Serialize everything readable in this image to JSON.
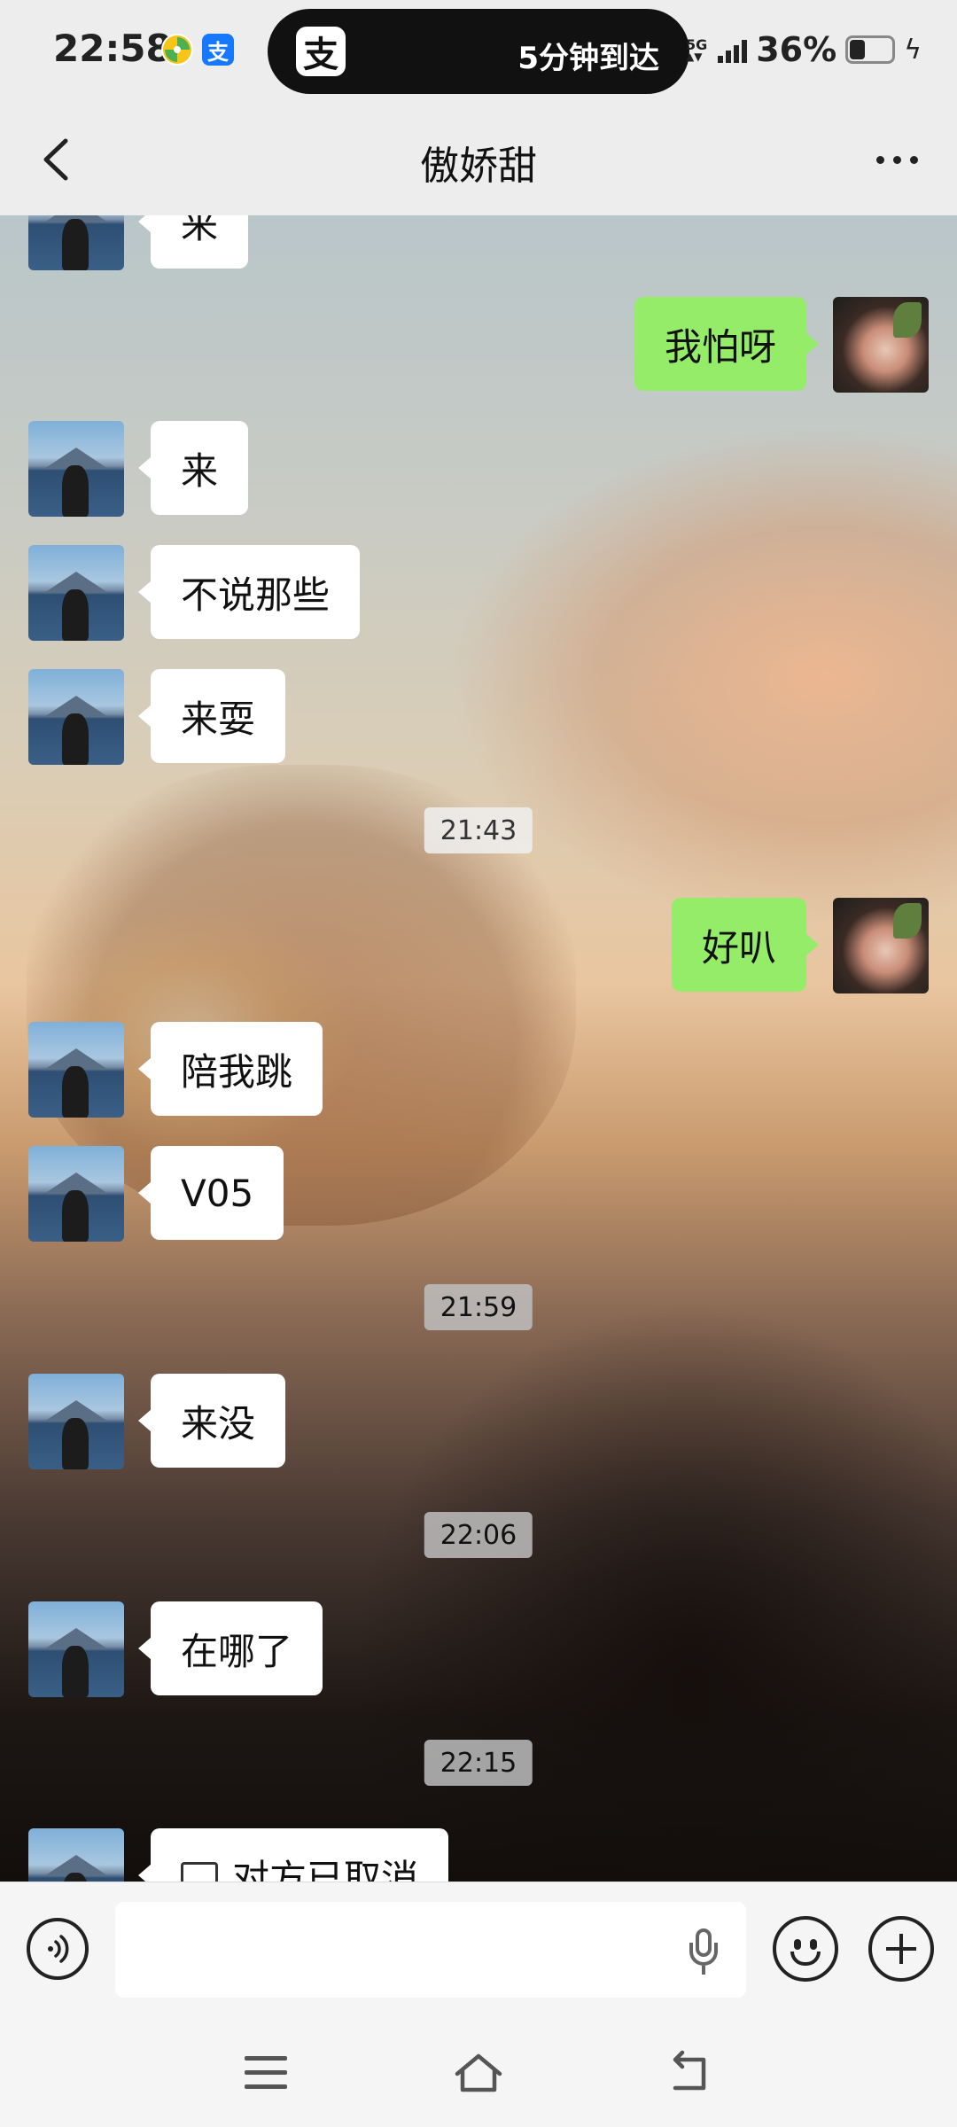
{
  "status_bar": {
    "time": "22:58",
    "app_icons": [
      "pinwheel-icon",
      "alipay-icon"
    ],
    "island_logo": "支",
    "island_text": "5分钟到达",
    "network": "5G",
    "battery_percent": "36%",
    "battery_level": 0.36,
    "charging": true
  },
  "header": {
    "title": "傲娇甜",
    "back_icon": "chevron-left-icon",
    "more_icon": "more-horizontal-icon"
  },
  "messages": [
    {
      "type": "in",
      "text": "来"
    },
    {
      "type": "out",
      "text": "我怕呀"
    },
    {
      "type": "in",
      "text": "来"
    },
    {
      "type": "in",
      "text": "不说那些"
    },
    {
      "type": "in",
      "text": "来耍"
    },
    {
      "type": "time",
      "text": "21:43"
    },
    {
      "type": "out",
      "text": "好叭"
    },
    {
      "type": "in",
      "text": "陪我跳"
    },
    {
      "type": "in",
      "text": "V05"
    },
    {
      "type": "time",
      "text": "21:59"
    },
    {
      "type": "in",
      "text": "来没"
    },
    {
      "type": "time",
      "text": "22:06"
    },
    {
      "type": "in",
      "text": "在哪了"
    },
    {
      "type": "time",
      "text": "22:15"
    },
    {
      "type": "in-video",
      "text": "对方已取消"
    }
  ],
  "input": {
    "placeholder": "",
    "value": ""
  },
  "colors": {
    "background": "#ededed",
    "bubble_out": "#95ec69",
    "bubble_in": "#ffffff"
  },
  "navigation": {
    "icons": [
      "menu-icon",
      "home-icon",
      "back-icon"
    ]
  }
}
